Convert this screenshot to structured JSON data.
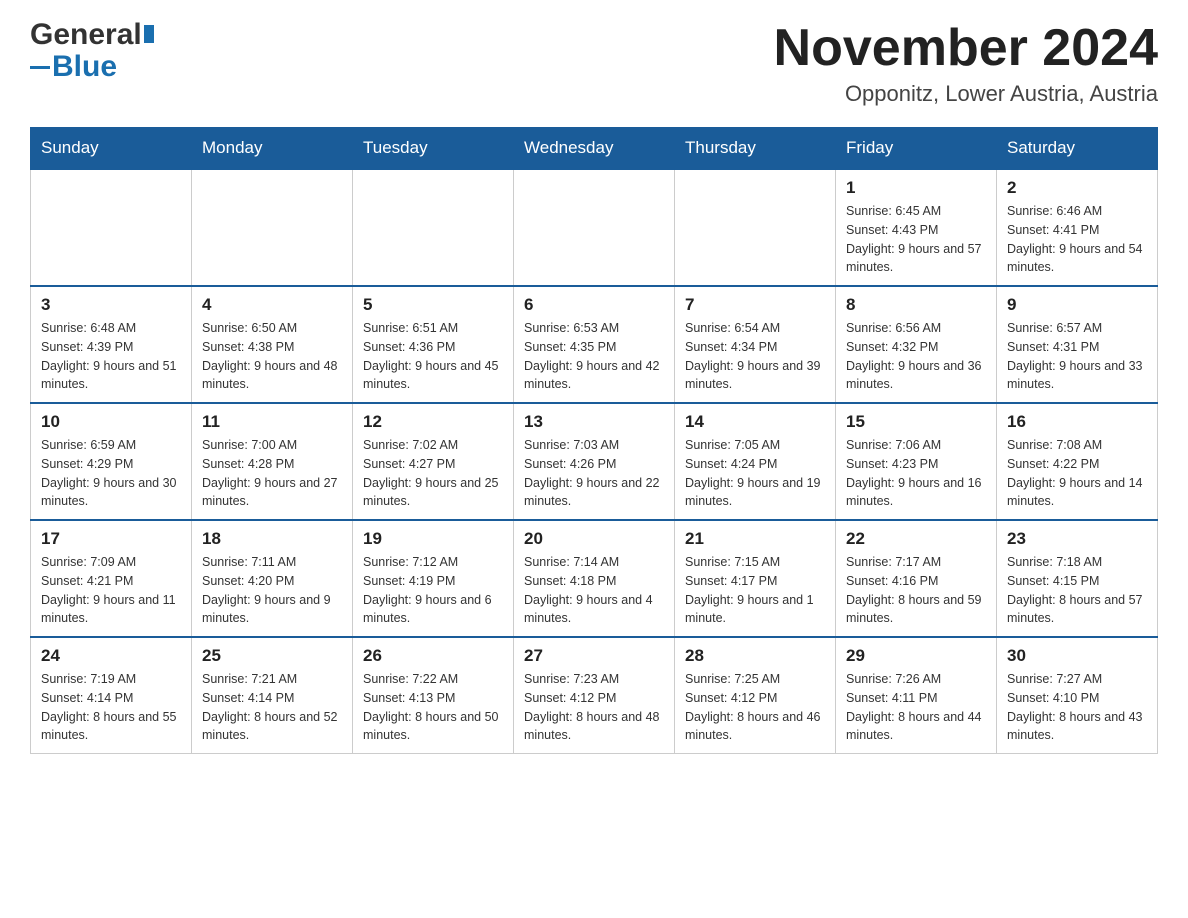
{
  "header": {
    "logo": {
      "name_part1": "General",
      "name_part2": "Blue"
    },
    "month_title": "November 2024",
    "location": "Opponitz, Lower Austria, Austria"
  },
  "weekdays": [
    "Sunday",
    "Monday",
    "Tuesday",
    "Wednesday",
    "Thursday",
    "Friday",
    "Saturday"
  ],
  "weeks": [
    [
      {
        "day": "",
        "sunrise": "",
        "sunset": "",
        "daylight": ""
      },
      {
        "day": "",
        "sunrise": "",
        "sunset": "",
        "daylight": ""
      },
      {
        "day": "",
        "sunrise": "",
        "sunset": "",
        "daylight": ""
      },
      {
        "day": "",
        "sunrise": "",
        "sunset": "",
        "daylight": ""
      },
      {
        "day": "",
        "sunrise": "",
        "sunset": "",
        "daylight": ""
      },
      {
        "day": "1",
        "sunrise": "Sunrise: 6:45 AM",
        "sunset": "Sunset: 4:43 PM",
        "daylight": "Daylight: 9 hours and 57 minutes."
      },
      {
        "day": "2",
        "sunrise": "Sunrise: 6:46 AM",
        "sunset": "Sunset: 4:41 PM",
        "daylight": "Daylight: 9 hours and 54 minutes."
      }
    ],
    [
      {
        "day": "3",
        "sunrise": "Sunrise: 6:48 AM",
        "sunset": "Sunset: 4:39 PM",
        "daylight": "Daylight: 9 hours and 51 minutes."
      },
      {
        "day": "4",
        "sunrise": "Sunrise: 6:50 AM",
        "sunset": "Sunset: 4:38 PM",
        "daylight": "Daylight: 9 hours and 48 minutes."
      },
      {
        "day": "5",
        "sunrise": "Sunrise: 6:51 AM",
        "sunset": "Sunset: 4:36 PM",
        "daylight": "Daylight: 9 hours and 45 minutes."
      },
      {
        "day": "6",
        "sunrise": "Sunrise: 6:53 AM",
        "sunset": "Sunset: 4:35 PM",
        "daylight": "Daylight: 9 hours and 42 minutes."
      },
      {
        "day": "7",
        "sunrise": "Sunrise: 6:54 AM",
        "sunset": "Sunset: 4:34 PM",
        "daylight": "Daylight: 9 hours and 39 minutes."
      },
      {
        "day": "8",
        "sunrise": "Sunrise: 6:56 AM",
        "sunset": "Sunset: 4:32 PM",
        "daylight": "Daylight: 9 hours and 36 minutes."
      },
      {
        "day": "9",
        "sunrise": "Sunrise: 6:57 AM",
        "sunset": "Sunset: 4:31 PM",
        "daylight": "Daylight: 9 hours and 33 minutes."
      }
    ],
    [
      {
        "day": "10",
        "sunrise": "Sunrise: 6:59 AM",
        "sunset": "Sunset: 4:29 PM",
        "daylight": "Daylight: 9 hours and 30 minutes."
      },
      {
        "day": "11",
        "sunrise": "Sunrise: 7:00 AM",
        "sunset": "Sunset: 4:28 PM",
        "daylight": "Daylight: 9 hours and 27 minutes."
      },
      {
        "day": "12",
        "sunrise": "Sunrise: 7:02 AM",
        "sunset": "Sunset: 4:27 PM",
        "daylight": "Daylight: 9 hours and 25 minutes."
      },
      {
        "day": "13",
        "sunrise": "Sunrise: 7:03 AM",
        "sunset": "Sunset: 4:26 PM",
        "daylight": "Daylight: 9 hours and 22 minutes."
      },
      {
        "day": "14",
        "sunrise": "Sunrise: 7:05 AM",
        "sunset": "Sunset: 4:24 PM",
        "daylight": "Daylight: 9 hours and 19 minutes."
      },
      {
        "day": "15",
        "sunrise": "Sunrise: 7:06 AM",
        "sunset": "Sunset: 4:23 PM",
        "daylight": "Daylight: 9 hours and 16 minutes."
      },
      {
        "day": "16",
        "sunrise": "Sunrise: 7:08 AM",
        "sunset": "Sunset: 4:22 PM",
        "daylight": "Daylight: 9 hours and 14 minutes."
      }
    ],
    [
      {
        "day": "17",
        "sunrise": "Sunrise: 7:09 AM",
        "sunset": "Sunset: 4:21 PM",
        "daylight": "Daylight: 9 hours and 11 minutes."
      },
      {
        "day": "18",
        "sunrise": "Sunrise: 7:11 AM",
        "sunset": "Sunset: 4:20 PM",
        "daylight": "Daylight: 9 hours and 9 minutes."
      },
      {
        "day": "19",
        "sunrise": "Sunrise: 7:12 AM",
        "sunset": "Sunset: 4:19 PM",
        "daylight": "Daylight: 9 hours and 6 minutes."
      },
      {
        "day": "20",
        "sunrise": "Sunrise: 7:14 AM",
        "sunset": "Sunset: 4:18 PM",
        "daylight": "Daylight: 9 hours and 4 minutes."
      },
      {
        "day": "21",
        "sunrise": "Sunrise: 7:15 AM",
        "sunset": "Sunset: 4:17 PM",
        "daylight": "Daylight: 9 hours and 1 minute."
      },
      {
        "day": "22",
        "sunrise": "Sunrise: 7:17 AM",
        "sunset": "Sunset: 4:16 PM",
        "daylight": "Daylight: 8 hours and 59 minutes."
      },
      {
        "day": "23",
        "sunrise": "Sunrise: 7:18 AM",
        "sunset": "Sunset: 4:15 PM",
        "daylight": "Daylight: 8 hours and 57 minutes."
      }
    ],
    [
      {
        "day": "24",
        "sunrise": "Sunrise: 7:19 AM",
        "sunset": "Sunset: 4:14 PM",
        "daylight": "Daylight: 8 hours and 55 minutes."
      },
      {
        "day": "25",
        "sunrise": "Sunrise: 7:21 AM",
        "sunset": "Sunset: 4:14 PM",
        "daylight": "Daylight: 8 hours and 52 minutes."
      },
      {
        "day": "26",
        "sunrise": "Sunrise: 7:22 AM",
        "sunset": "Sunset: 4:13 PM",
        "daylight": "Daylight: 8 hours and 50 minutes."
      },
      {
        "day": "27",
        "sunrise": "Sunrise: 7:23 AM",
        "sunset": "Sunset: 4:12 PM",
        "daylight": "Daylight: 8 hours and 48 minutes."
      },
      {
        "day": "28",
        "sunrise": "Sunrise: 7:25 AM",
        "sunset": "Sunset: 4:12 PM",
        "daylight": "Daylight: 8 hours and 46 minutes."
      },
      {
        "day": "29",
        "sunrise": "Sunrise: 7:26 AM",
        "sunset": "Sunset: 4:11 PM",
        "daylight": "Daylight: 8 hours and 44 minutes."
      },
      {
        "day": "30",
        "sunrise": "Sunrise: 7:27 AM",
        "sunset": "Sunset: 4:10 PM",
        "daylight": "Daylight: 8 hours and 43 minutes."
      }
    ]
  ]
}
